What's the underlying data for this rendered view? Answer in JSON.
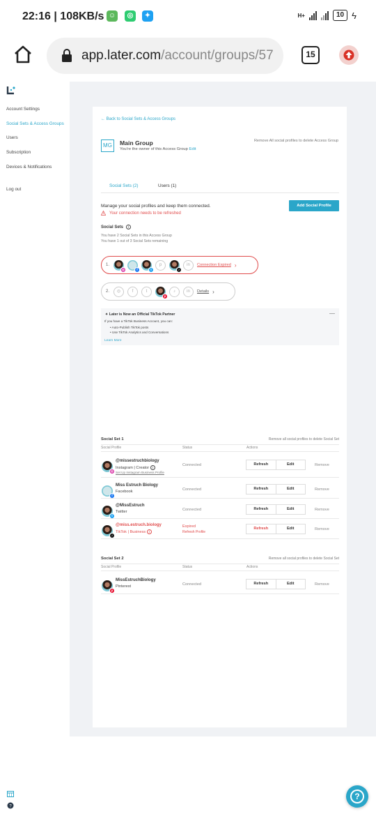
{
  "status_bar": {
    "time": "22:16",
    "speed": "108KB/s",
    "network": "H+",
    "battery": "10"
  },
  "browser": {
    "url_host": "app.later.com",
    "url_path": "/account/groups/57",
    "tab_count": "15"
  },
  "sidebar": {
    "items": [
      {
        "label": "Account Settings"
      },
      {
        "label": "Social Sets & Access Groups"
      },
      {
        "label": "Users"
      },
      {
        "label": "Subscription"
      },
      {
        "label": "Devices & Notifications"
      },
      {
        "label": "Log out"
      }
    ],
    "active_index": 1
  },
  "back_link": "Back to Social Sets & Access Groups",
  "group": {
    "badge": "MG",
    "title": "Main Group",
    "subtitle": "You're the owner of this Access Group",
    "edit": "Edit",
    "remove_all": "Remove All social profiles to delete Access Group"
  },
  "tabs": [
    {
      "label": "Social Sets (2)"
    },
    {
      "label": "Users (1)"
    }
  ],
  "manage_text": "Manage your social profiles and keep them connected.",
  "warning_text": "Your connection needs to be refreshed",
  "add_button": "Add Social Profile",
  "social_sets_section": {
    "label": "Social Sets",
    "note1": "You have 2 Social Sets in this Access Group",
    "note2": "You have 1 out of 3 Social Sets remaining"
  },
  "set_pills": [
    {
      "number": "1.",
      "link": "Connection Expired"
    },
    {
      "number": "2.",
      "link": "Details"
    }
  ],
  "tiktok_banner": {
    "title": "Later is Now an Official TikTok Partner",
    "intro": "If you have a TikTok Business Account, you can:",
    "bullets": [
      "Auto-Publish TikTok posts",
      "Use TikTok Analytics and Conversations"
    ],
    "more": "Learn More"
  },
  "table_columns": {
    "profile": "Social Profile",
    "status": "Status",
    "actions": "Actions"
  },
  "sets": [
    {
      "title": "Social Set 1",
      "remove_all": "Remove all social profiles to delete Social Set",
      "rows": [
        {
          "name": "@missestruchbiology",
          "type": "Instagram | Creator",
          "link": "Set Up Instagram Business Profile",
          "status": "Connected",
          "refresh": "Refresh",
          "edit": "Edit",
          "remove": "Remove",
          "badge_color": "#d6249f"
        },
        {
          "name": "Miss Estruch Biology",
          "type": "Facebook",
          "status": "Connected",
          "refresh": "Refresh",
          "edit": "Edit",
          "remove": "Remove",
          "badge_color": "#1877f2"
        },
        {
          "name": "@MissEstruch",
          "type": "Twitter",
          "status": "Connected",
          "refresh": "Refresh",
          "edit": "Edit",
          "remove": "Remove",
          "badge_color": "#1da1f2"
        },
        {
          "name": "@miss.estruch.biology",
          "type": "TikTok | Business",
          "status": "Expired",
          "status_sub": "Refresh Profile",
          "refresh": "Refresh",
          "edit": "Edit",
          "remove": "Remove",
          "badge_color": "#111111"
        }
      ]
    },
    {
      "title": "Social Set 2",
      "remove_all": "Remove all social profiles to delete Social Set",
      "rows": [
        {
          "name": "MissEstruchBiology",
          "type": "Pinterest",
          "status": "Connected",
          "refresh": "Refresh",
          "edit": "Edit",
          "remove": "Remove",
          "badge_color": "#e60023"
        }
      ]
    }
  ],
  "colors": {
    "accent": "#2aa6c9",
    "error": "#e04b4b"
  }
}
